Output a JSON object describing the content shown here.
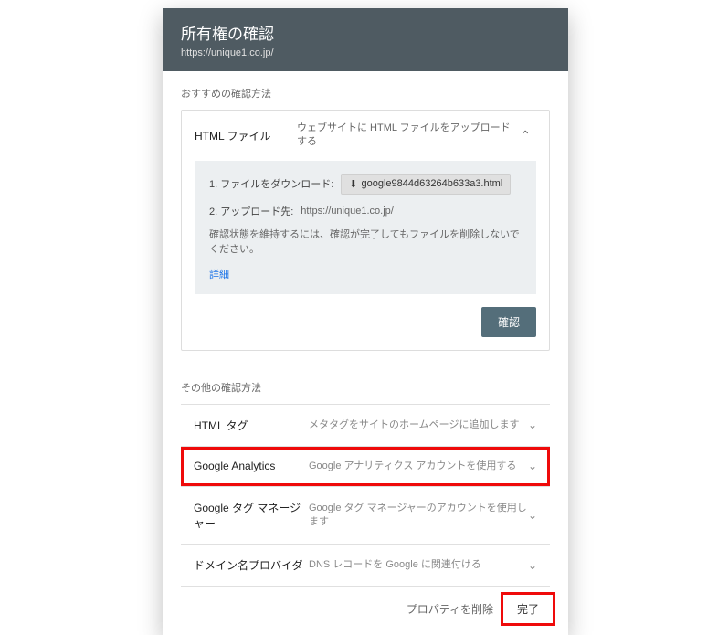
{
  "header": {
    "title": "所有権の確認",
    "url": "https://unique1.co.jp/"
  },
  "recommended": {
    "label": "おすすめの確認方法",
    "method_title": "HTML ファイル",
    "method_desc": "ウェブサイトに HTML ファイルをアップロードする",
    "step1_label": "1. ファイルをダウンロード:",
    "download_filename": "google9844d63264b633a3.html",
    "step2_label": "2. アップロード先:",
    "step2_url": "https://unique1.co.jp/",
    "note": "確認状態を維持するには、確認が完了してもファイルを削除しないでください。",
    "detail": "詳細",
    "verify": "確認"
  },
  "other": {
    "label": "その他の確認方法",
    "items": [
      {
        "title": "HTML タグ",
        "desc": "メタタグをサイトのホームページに追加します",
        "highlight": false
      },
      {
        "title": "Google Analytics",
        "desc": "Google アナリティクス アカウントを使用する",
        "highlight": true
      },
      {
        "title": "Google タグ マネージャー",
        "desc": "Google タグ マネージャーのアカウントを使用します",
        "highlight": false
      },
      {
        "title": "ドメイン名プロバイダ",
        "desc": "DNS レコードを Google に関連付ける",
        "highlight": false
      }
    ]
  },
  "footer": {
    "remove": "プロパティを削除",
    "done": "完了"
  }
}
